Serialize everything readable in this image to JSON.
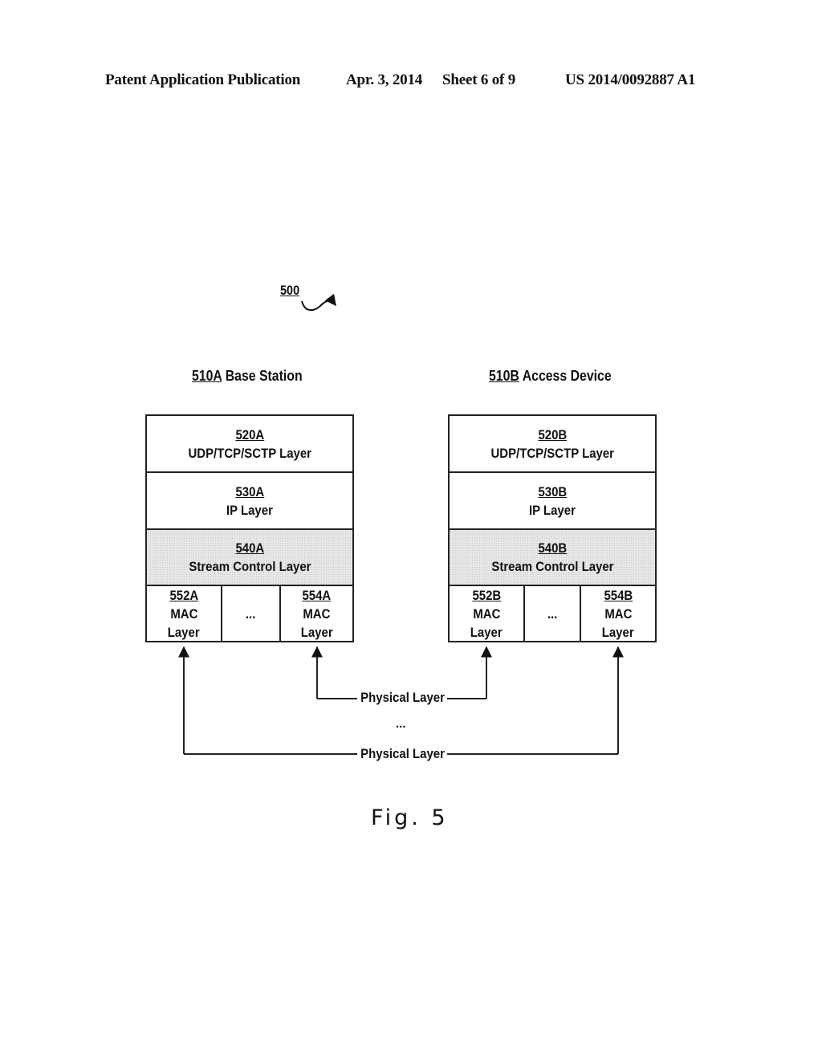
{
  "header": {
    "publication": "Patent Application Publication",
    "date": "Apr. 3, 2014",
    "sheet": "Sheet 6 of 9",
    "patent_number": "US 2014/0092887 A1"
  },
  "figure": {
    "reference": "500",
    "caption": "Fig. 5"
  },
  "base_station": {
    "ref": "510A",
    "name": "Base Station",
    "layers": [
      {
        "ref": "520A",
        "name": "UDP/TCP/SCTP Layer",
        "shaded": false
      },
      {
        "ref": "530A",
        "name": "IP Layer",
        "shaded": false
      },
      {
        "ref": "540A",
        "name": "Stream Control Layer",
        "shaded": true
      }
    ],
    "mac_layers": [
      {
        "ref": "552A",
        "line1": "MAC",
        "line2": "Layer"
      },
      {
        "ellipsis": "..."
      },
      {
        "ref": "554A",
        "line1": "MAC",
        "line2": "Layer"
      }
    ]
  },
  "access_device": {
    "ref": "510B",
    "name": "Access Device",
    "layers": [
      {
        "ref": "520B",
        "name": "UDP/TCP/SCTP Layer",
        "shaded": false
      },
      {
        "ref": "530B",
        "name": "IP Layer",
        "shaded": false
      },
      {
        "ref": "540B",
        "name": "Stream Control Layer",
        "shaded": true
      }
    ],
    "mac_layers": [
      {
        "ref": "552B",
        "line1": "MAC",
        "line2": "Layer"
      },
      {
        "ellipsis": "..."
      },
      {
        "ref": "554B",
        "line1": "MAC",
        "line2": "Layer"
      }
    ]
  },
  "connections": [
    {
      "label": "Physical Layer",
      "from": "554A",
      "to": "552B"
    },
    {
      "label": "Physical Layer",
      "from": "552A",
      "to": "554B"
    }
  ],
  "connections_ellipsis": "...",
  "colors": {
    "line": "#222222",
    "shade": "#e6e6e6"
  }
}
